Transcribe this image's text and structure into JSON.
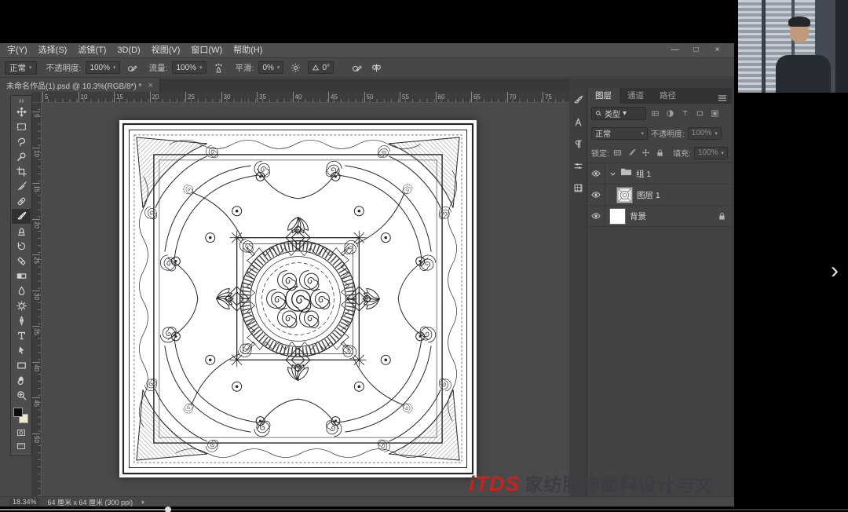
{
  "window": {
    "controls": [
      {
        "name": "minimize",
        "glyph": "—"
      },
      {
        "name": "restore",
        "glyph": "□"
      },
      {
        "name": "close",
        "glyph": "×"
      }
    ]
  },
  "menu_bar": {
    "items": [
      "字(Y)",
      "选择(S)",
      "滤镜(T)",
      "3D(D)",
      "视图(V)",
      "窗口(W)",
      "帮助(H)"
    ]
  },
  "options_bar": {
    "blend_mode": "正常",
    "opacity_label": "不透明度:",
    "opacity_value": "100%",
    "flow_label": "流量:",
    "flow_value": "100%",
    "smoothing_label": "平滑:",
    "smoothing_value": "0%",
    "angle_value": "0°"
  },
  "document_tab": {
    "title": "未命名作品(1).psd @ 10.3%(RGB/8*) *",
    "close_glyph": "×"
  },
  "rulers": {
    "top": [
      "5",
      "10",
      "15",
      "20",
      "25",
      "30",
      "35",
      "40",
      "45",
      "50",
      "55",
      "60",
      "65",
      "70",
      "75"
    ],
    "left": [
      "5",
      "10",
      "15",
      "20",
      "25",
      "30",
      "35",
      "40",
      "45",
      "50"
    ]
  },
  "toolbar": {
    "active_tool": "brush",
    "tools": [
      "move",
      "marquee",
      "lasso",
      "quick-select",
      "crop",
      "eyedropper",
      "healing-brush",
      "brush",
      "clone-stamp",
      "history-brush",
      "eraser",
      "gradient",
      "blur",
      "dodge",
      "pen",
      "type",
      "path-select",
      "shape",
      "hand",
      "zoom"
    ]
  },
  "right_dock": {
    "icons": [
      "brush-settings",
      "character",
      "paragraph",
      "properties",
      "info"
    ]
  },
  "layers_panel": {
    "tabs": [
      {
        "label": "图层",
        "active": true
      },
      {
        "label": "通道",
        "active": false
      },
      {
        "label": "路径",
        "active": false
      }
    ],
    "filter_kind_label": "类型",
    "blend_mode": "正常",
    "opacity_label": "不透明度:",
    "opacity_value": "100%",
    "lock_label": "锁定:",
    "fill_label": "填充:",
    "fill_value": "100%",
    "layers": [
      {
        "name": "组 1",
        "type": "group"
      },
      {
        "name": "图层 1",
        "type": "artwork"
      },
      {
        "name": "背景",
        "type": "background"
      }
    ]
  },
  "status_bar": {
    "zoom": "18.34%",
    "doc_info": "64 厘米 x 64 厘米 (300 ppi)"
  },
  "watermark": {
    "logo": "iTDS",
    "text": "家纺服饰面料设计与文"
  },
  "player": {
    "next_glyph": "›"
  },
  "colors": {
    "watermark_red": "#c4241d"
  }
}
